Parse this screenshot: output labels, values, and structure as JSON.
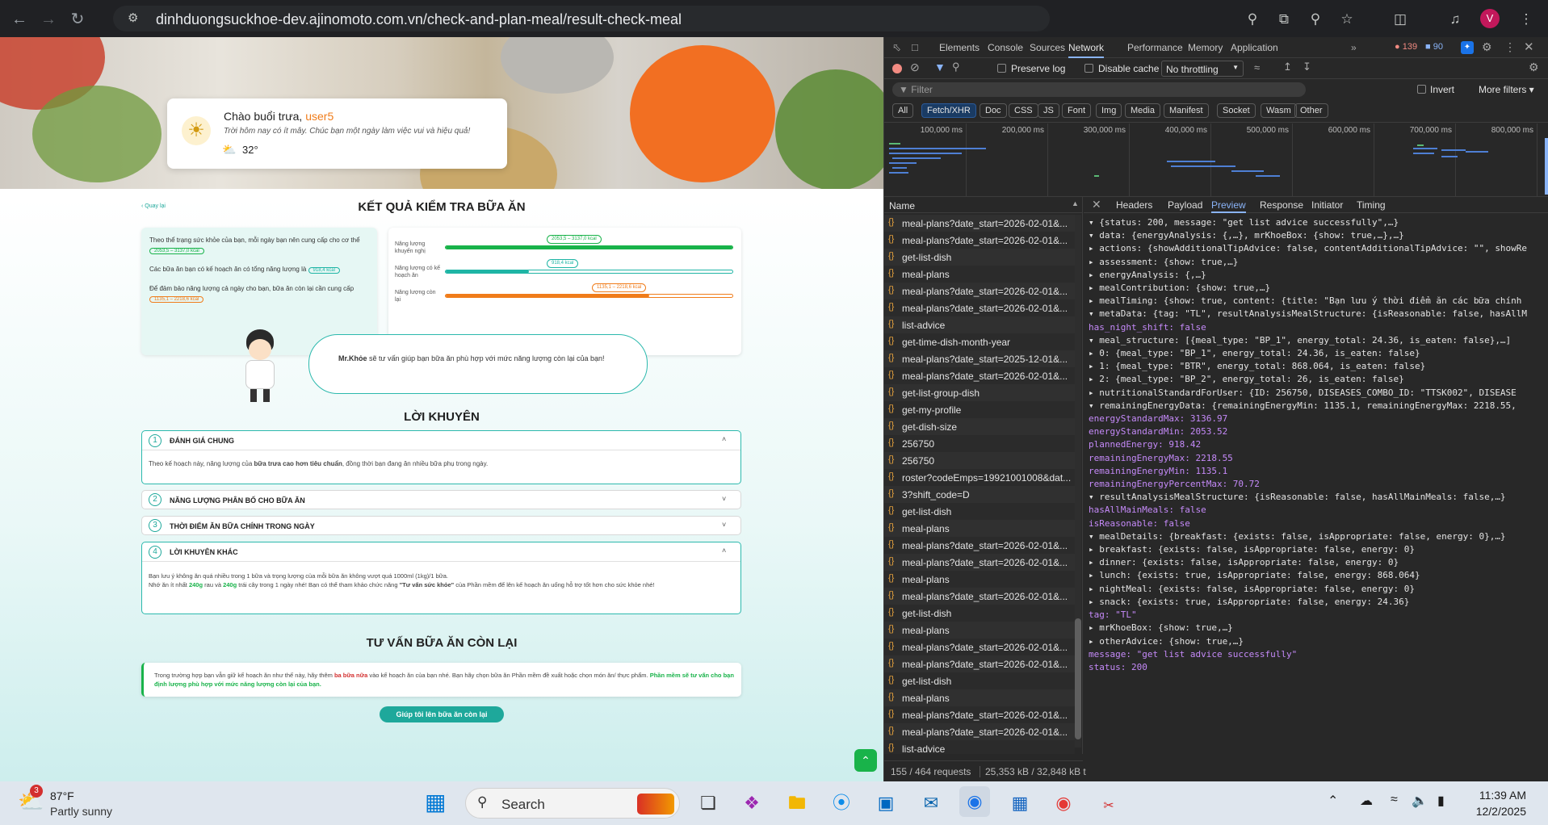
{
  "browser": {
    "url": "dinhduongsuckhoe-dev.ajinomoto.com.vn/check-and-plan-meal/result-check-meal",
    "profile_initial": "V"
  },
  "page": {
    "greeting": "Chào buổi trưa,",
    "username": "user5",
    "greeting_sub": "Trời hôm nay có ít mây. Chúc bạn một ngày làm việc vui và hiệu quả!",
    "temperature": "32°",
    "back_link": "Quay lại",
    "title": "KẾT QUẢ KIỂM TRA BỮA ĂN",
    "summary": {
      "line1_a": "Theo thể trạng sức khỏe của bạn, mỗi ngày bạn nên cung cấp cho cơ thể",
      "line1_badge": "2053,5 – 3137,0 kcal",
      "line2_a": "Các bữa ăn bạn có kế hoạch ăn có tổng năng lượng là",
      "line2_badge": "918,4 kcal",
      "line3_a": "Để đảm bảo năng lượng cả ngày cho bạn, bữa ăn còn lại cần cung cấp",
      "line3_badge": "1135,1 – 2218,6 kcal"
    },
    "bars": [
      {
        "label": "Năng lượng khuyến nghị",
        "badge": "2053,5 – 3137,0 kcal",
        "fill": 1.0,
        "color": "#19b34a"
      },
      {
        "label": "Năng lượng có kế hoạch ăn",
        "badge": "918,4 kcal",
        "fill": 0.29,
        "color": "#1fb5a5"
      },
      {
        "label": "Năng lượng còn lại",
        "badge": "1135,1 – 2218,6 kcal",
        "fill": 0.71,
        "color": "#f07c1a"
      }
    ],
    "mrkhoe_name": "Mr.Khỏe",
    "mrkhoe_text": " sẽ tư vấn giúp bạn bữa ăn phù hợp với mức năng lượng còn lại của bạn!",
    "advice_title": "LỜI KHUYÊN",
    "sections": [
      {
        "num": "1",
        "title": "ĐÁNH GIÁ CHUNG",
        "open": true
      },
      {
        "num": "2",
        "title": "NĂNG LƯỢNG PHÂN BỐ CHO BỮA ĂN",
        "open": false
      },
      {
        "num": "3",
        "title": "THỜI ĐIỂM ĂN BỮA CHÍNH TRONG NGÀY",
        "open": false
      },
      {
        "num": "4",
        "title": "LỜI KHUYÊN KHÁC",
        "open": true
      }
    ],
    "sec1_text_a": "Theo kế hoạch này, năng lượng của ",
    "sec1_text_b": "bữa trưa cao hơn tiêu chuẩn",
    "sec1_text_c": ", đồng thời bạn đang ăn nhiều bữa phụ trong ngày.",
    "sec4_line1": "Bạn lưu ý không ăn quá nhiều trong 1 bữa và trọng lượng của mỗi bữa ăn không vượt quá 1000ml (1kg)/1 bữa.",
    "sec4_line2_a": "Nhớ ăn ít nhất ",
    "sec4_line2_b": "240g",
    "sec4_line2_c": " rau và ",
    "sec4_line2_d": "240g",
    "sec4_line2_e": " trái cây trong 1 ngày nhé! Bạn có thể tham khảo chức năng ",
    "sec4_line2_f": "\"Tư vấn sức khỏe\"",
    "sec4_line2_g": " của Phần mềm để lên kế hoạch ăn uống hỗ trợ tốt hơn cho sức khỏe nhé!",
    "remain_title": "TƯ VẤN BỮA ĂN CÒN LẠI",
    "remain_a": "Trong trường hợp bạn vẫn giữ kế hoạch ăn như thế này, hãy thêm ",
    "remain_b": "ba bữa nữa",
    "remain_c": " vào kế hoạch ăn của bạn nhé. Bạn hãy chọn bữa ăn Phần mềm đề xuất hoặc chọn món ăn/ thực phẩm. ",
    "remain_d": "Phần mềm sẽ tư vấn cho bạn định lượng phù hợp với mức năng lượng còn lại của bạn.",
    "cta": "Giúp tôi lên bữa ăn còn lại"
  },
  "devtools": {
    "tabs": [
      "Elements",
      "Console",
      "Sources",
      "Network",
      "Performance",
      "Memory",
      "Application"
    ],
    "active_tab": "Network",
    "errors": "139",
    "warnings": "90",
    "preserve_log": "Preserve log",
    "disable_cache": "Disable cache",
    "throttle": "No throttling",
    "filter_placeholder": "Filter",
    "invert": "Invert",
    "more_filters": "More filters",
    "type_filters": [
      "All",
      "Fetch/XHR",
      "Doc",
      "CSS",
      "JS",
      "Font",
      "Img",
      "Media",
      "Manifest",
      "Socket",
      "Wasm",
      "Other"
    ],
    "active_type": "Fetch/XHR",
    "timeline_ticks": [
      "100,000 ms",
      "200,000 ms",
      "300,000 ms",
      "400,000 ms",
      "500,000 ms",
      "600,000 ms",
      "700,000 ms",
      "800,000 ms"
    ],
    "name_header": "Name",
    "requests": [
      "meal-plans?date_start=2026-02-01&...",
      "meal-plans?date_start=2026-02-01&...",
      "get-list-dish",
      "meal-plans",
      "meal-plans?date_start=2026-02-01&...",
      "meal-plans?date_start=2026-02-01&...",
      "list-advice",
      "get-time-dish-month-year",
      "meal-plans?date_start=2025-12-01&...",
      "meal-plans?date_start=2026-02-01&...",
      "get-list-group-dish",
      "get-my-profile",
      "get-dish-size",
      "256750",
      "256750",
      "roster?codeEmps=19921001008&dat...",
      "3?shift_code=D",
      "get-list-dish",
      "meal-plans",
      "meal-plans?date_start=2026-02-01&...",
      "meal-plans?date_start=2026-02-01&...",
      "meal-plans",
      "meal-plans?date_start=2026-02-01&...",
      "get-list-dish",
      "meal-plans",
      "meal-plans?date_start=2026-02-01&...",
      "meal-plans?date_start=2026-02-01&...",
      "get-list-dish",
      "meal-plans",
      "meal-plans?date_start=2026-02-01&...",
      "meal-plans?date_start=2026-02-01&...",
      "list-advice"
    ],
    "status_requests": "155 / 464 requests",
    "status_size": "25,353 kB / 32,848 kB t",
    "detail_tabs": [
      "Headers",
      "Payload",
      "Preview",
      "Response",
      "Initiator",
      "Timing"
    ],
    "active_detail": "Preview",
    "preview_lines": [
      "▾ {status: 200, message: \"get list advice successfully\",…}",
      "  ▾ data: {energyAnalysis: {,…}, mrKhoeBox: {show: true,…},…}",
      "    ▸ actions: {showAdditionalTipAdvice: false, contentAdditionalTipAdvice: \"\", showRe",
      "    ▸ assessment: {show: true,…}",
      "    ▸ energyAnalysis: {,…}",
      "    ▸ mealContribution: {show: true,…}",
      "    ▸ mealTiming: {show: true, content: {title: \"Bạn lưu ý thời điểm ăn các bữa chính",
      "    ▾ metaData: {tag: \"TL\", resultAnalysisMealStructure: {isReasonable: false, hasAllM",
      "        has_night_shift: false",
      "      ▾ meal_structure: [{meal_type: \"BP_1\", energy_total: 24.36, is_eaten: false},…]",
      "        ▸ 0: {meal_type: \"BP_1\", energy_total: 24.36, is_eaten: false}",
      "        ▸ 1: {meal_type: \"BTR\", energy_total: 868.064, is_eaten: false}",
      "        ▸ 2: {meal_type: \"BP_2\", energy_total: 26, is_eaten: false}",
      "      ▸ nutritionalStandardForUser: {ID: 256750, DISEASES_COMBO_ID: \"TTSK002\", DISEASE",
      "      ▾ remainingEnergyData: {remainingEnergyMin: 1135.1, remainingEnergyMax: 2218.55,",
      "          energyStandardMax: 3136.97",
      "          energyStandardMin: 2053.52",
      "          plannedEnergy: 918.42",
      "          remainingEnergyMax: 2218.55",
      "          remainingEnergyMin: 1135.1",
      "          remainingEnergyPercentMax: 70.72",
      "      ▾ resultAnalysisMealStructure: {isReasonable: false, hasAllMainMeals: false,…}",
      "          hasAllMainMeals: false",
      "          isReasonable: false",
      "        ▾ mealDetails: {breakfast: {exists: false, isAppropriate: false, energy: 0},…}",
      "          ▸ breakfast: {exists: false, isAppropriate: false, energy: 0}",
      "          ▸ dinner: {exists: false, isAppropriate: false, energy: 0}",
      "          ▸ lunch: {exists: true, isAppropriate: false, energy: 868.064}",
      "          ▸ nightMeal: {exists: false, isAppropriate: false, energy: 0}",
      "          ▸ snack: {exists: true, isAppropriate: false, energy: 24.36}",
      "        tag: \"TL\"",
      "    ▸ mrKhoeBox: {show: true,…}",
      "    ▸ otherAdvice: {show: true,…}",
      "    message: \"get list advice successfully\"",
      "    status: 200"
    ]
  },
  "taskbar": {
    "weather_temp": "87°F",
    "weather_desc": "Partly sunny",
    "weather_badge": "3",
    "search": "Search",
    "time": "11:39 AM",
    "date": "12/2/2025"
  }
}
